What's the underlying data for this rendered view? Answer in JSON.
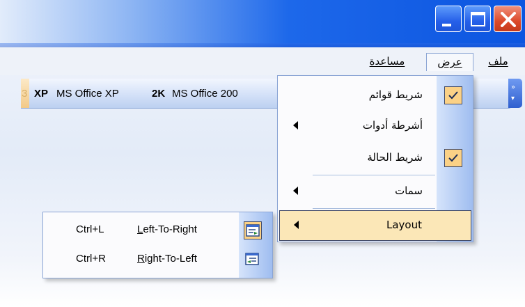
{
  "menubar": {
    "file": "ملف",
    "view": "عرض",
    "help": "مساعدة"
  },
  "toolbar": {
    "xp_badge": "XP",
    "xp_label": "MS Office XP",
    "k2_badge": "2K",
    "k2_label": "MS Office 200",
    "edge_fragment": "3"
  },
  "view_menu": {
    "items": [
      {
        "label": "شريط قوائم",
        "checked": true
      },
      {
        "label": "أشرطة أدوات",
        "submenu": true
      },
      {
        "label": "شريط الحالة",
        "checked": true
      },
      {
        "label": "سمات",
        "submenu": true
      },
      {
        "label": "Layout",
        "submenu": true,
        "highlighted": true
      }
    ]
  },
  "layout_submenu": {
    "items": [
      {
        "label_u": "L",
        "label_rest": "eft-To-Right",
        "shortcut": "Ctrl+L",
        "icon": "ltr-layout-icon",
        "active": true
      },
      {
        "label_u": "R",
        "label_rest": "ight-To-Left",
        "shortcut": "Ctrl+R",
        "icon": "rtl-layout-icon",
        "active": false
      }
    ]
  },
  "colors": {
    "titlebar": "#0c55e0",
    "menu_highlight": "#fbe7b7",
    "check_bg": "#fbd186",
    "gutter": "#9fbdf0"
  }
}
